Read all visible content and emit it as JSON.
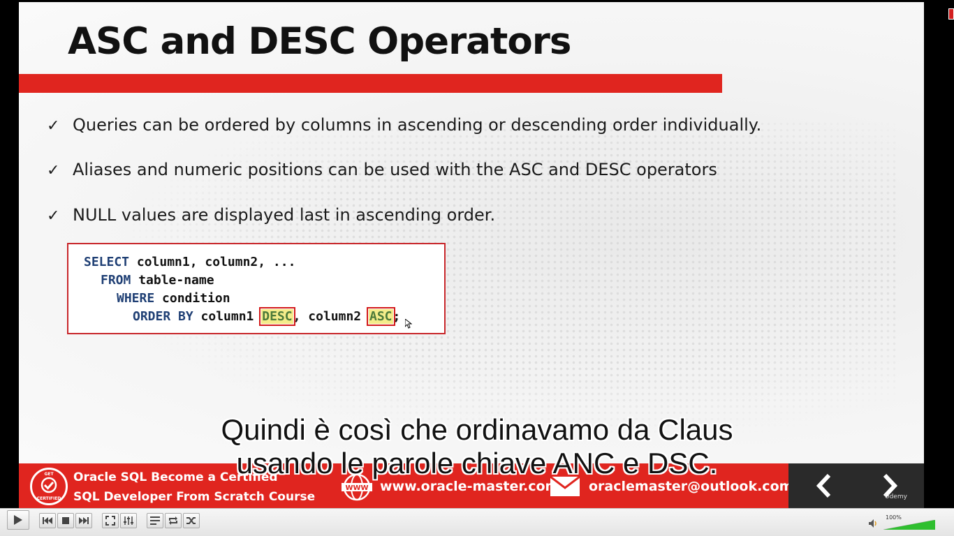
{
  "slide": {
    "title": "ASC and DESC Operators",
    "bullets": [
      "Queries can be ordered by columns in ascending or descending order individually.",
      "Aliases and numeric positions can be used with the ASC and DESC operators",
      "NULL values are displayed last in ascending order."
    ],
    "check_glyph": "✓",
    "code": {
      "line1_kw": "SELECT",
      "line1_rest": " column1, column2, ...",
      "line2_kw": "FROM",
      "line2_rest": " table-name",
      "line3_kw": "WHERE",
      "line3_rest": " condition",
      "line4_kw": "ORDER BY",
      "line4_a": " column1 ",
      "line4_desc": "DESC",
      "line4_b": ", column2 ",
      "line4_asc": "ASC",
      "line4_end": ";"
    }
  },
  "subtitles": {
    "line1": "Quindi è così che ordinavamo da Claus",
    "line2": "usando le parole chiave ANC e DSC."
  },
  "footer": {
    "badge_top": "GET",
    "badge_bottom": "CERTIFIED",
    "course_line1": "Oracle SQL Become a Certified",
    "course_line2": "SQL  Developer  From Scratch Course",
    "website": "www.oracle-master.com",
    "email": "oraclemaster@outlook.com",
    "brand": "Udemy"
  },
  "player": {
    "volume_label": "100%",
    "volume_level": 1.0
  },
  "colors": {
    "accent_red": "#e0251f",
    "keyword_blue": "#1f3f74",
    "highlight_yellow": "#f4ec8a"
  }
}
